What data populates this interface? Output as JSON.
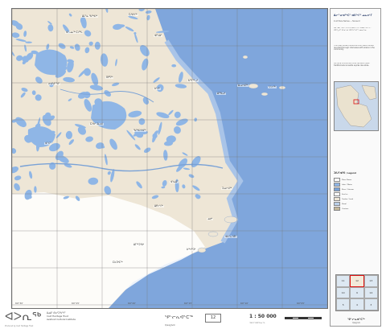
{
  "map": {
    "sheet_title": "ᕿᓪᓕᕆᐊᓐᑕᖅ",
    "sheet_subtitle": "Qaajjivik",
    "sheet_number": "12",
    "scale": "1 : 50 000",
    "scale_sub": "ᑐᑭᓯᒋᐊᕈᑕᐅᓂᖓ",
    "colors": {
      "land": "#eee6d6",
      "water": "#7fa6dc",
      "lake": "#8fb6e6",
      "ice": "#ffffff",
      "river": "#7aa2d6",
      "grid": "#777777"
    }
  },
  "places": [
    {
      "text": "ᐃᒪᓐᓇ ᖃᖅᑲᖅ"
    },
    {
      "text": "ᑕᓯᐅᔭᖅ"
    },
    {
      "text": "ᐊᓪᓗᓇᖅ ᑕᓯᖓ"
    },
    {
      "text": "ᐊᒥᒐᐃᑦ"
    },
    {
      "text": "ᓂᐊᖁᓐᖑᑦ"
    },
    {
      "text": "ᑎᑭᕋᖅ"
    },
    {
      "text": "ᐅᔾᔪᒃ"
    },
    {
      "text": "ᑲᖏᖅᓗᒃ"
    },
    {
      "text": "ᐃᕐᖃᓗᒃ"
    },
    {
      "text": "ᓴᓪᓕᖅ"
    },
    {
      "text": "ᐃᓗᓕᐊᖅ"
    },
    {
      "text": "ᑕᓯᐅᑉ ᐃᓗᐊ"
    },
    {
      "text": "ᐊᑉᐸᑦ"
    },
    {
      "text": "ᖃᖅᑲᕐᔪᐊᖅ"
    },
    {
      "text": "ᐊᕐᓇᐃᑦ"
    },
    {
      "text": "ᑐᓄᓕᐊᖅ"
    },
    {
      "text": "ᐃᑭᓕᓴᖅ"
    },
    {
      "text": "ᓄᕙᒃ"
    },
    {
      "text": "ᐃᒥᖅᑐᕐᕕᒃ"
    },
    {
      "text": "ᐅᖅᓯᒃᑐᒃ"
    },
    {
      "text": "ᐊᐅᓪᓚᕐᕕᒃ"
    },
    {
      "text": "ᑕᐅᑐᒃᑕᖅ"
    }
  ],
  "coords": {
    "bottom": [
      "69°30'",
      "69°25'",
      "69°20'",
      "69°15'",
      "69°10'",
      "69°05'"
    ]
  },
  "side": {
    "title": "ᐃᓕᓐᓂᐊᖅᑕᑦ ᐊᑎᖏᑦ ᓄᓇᕗᒻᒥ",
    "subtitle": "Inuit Place Names — Nunavut",
    "desc1": "ᐅᓇ ᓄᓇᙳᐊᖅ ᐊᑐᖅᑕᐅᓂᐊᖅᑐᖅ ᐃᓄᐃᑦ ᐊᑎᖏᑦ ᐊᑐᖅᖢᒋᑦ ᐃᓐᓇᕐᓄᑦ ᐊᐱᖅᓱᖅᓱᒋᑦ ᓄᓇᓕᖕᓂ.",
    "desc2": "This map shows traditional Inuit place names recorded through interviews with elders in the community.",
    "desc3": "Ce carte montre les noms de lieux inuits traditionnels recueillis auprès des aînés.",
    "legend_title": "ᑐᑭᓯᒋᐊᕈᑎ / Legend",
    "legend": [
      {
        "label": "Place Name",
        "color": "#ffffff"
      },
      {
        "label": "Lake / Water",
        "color": "#8fb6e6"
      },
      {
        "label": "River / Stream",
        "color": "#7aa2d6"
      },
      {
        "label": "Sea Ice",
        "color": "#ffffff"
      },
      {
        "label": "Tundra / Land",
        "color": "#eee6d6"
      },
      {
        "label": "Shoal",
        "color": "#b9cfe9"
      },
      {
        "label": "Contour",
        "color": "#c4b89a"
      }
    ],
    "index_cells": [
      "11",
      "12",
      "13",
      "10",
      "9",
      "14",
      "5",
      "4",
      "3"
    ],
    "sheet_name": "ᕿᓪᓕᕆᐊᓐᑕᖅ",
    "sheet_name_sub": "Qaajjivik"
  },
  "footer": {
    "logo": "ᐊᐳᕆᖅ",
    "org_iu": "ᐃᓄᐃᑦ ᐱᐅᓯᑐᖃᖏᑦ",
    "org_en1": "Inuit Heritage Trust",
    "org_en2": "Avativut Cultural Institute",
    "credit": "Produced by Inuit Heritage Trust"
  }
}
